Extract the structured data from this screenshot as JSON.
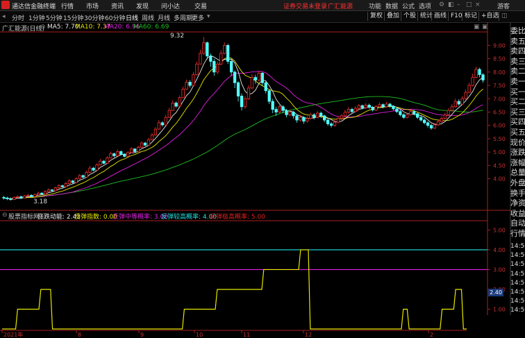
{
  "app": {
    "title": "通达信金融终端"
  },
  "menu": {
    "items": [
      "行情",
      "市场",
      "资讯",
      "发现",
      "问小达",
      "交易"
    ]
  },
  "menu_right": {
    "notice": "证券交易未登录",
    "account": "广汇能源",
    "items": [
      "功能",
      "数据",
      "公式",
      "选项"
    ],
    "guest": "游客"
  },
  "toolbar": {
    "periods": [
      "分时",
      "1分钟",
      "5分钟",
      "15分钟",
      "30分钟",
      "60分钟",
      "日线",
      "周线",
      "月线",
      "多周期",
      "更多"
    ],
    "active": "日线"
  },
  "toolbar_right": {
    "items": [
      "复权",
      "叠加",
      "个股",
      "统计",
      "画线",
      "F10",
      "标记",
      "+自选"
    ]
  },
  "main_chart": {
    "title": "广汇能源(日线)",
    "ma": [
      {
        "label": "MA5: 7.70",
        "color": "#e8e8e8"
      },
      {
        "label": "MA10: 7.37",
        "color": "#e8e800"
      },
      {
        "label": "MA20: 6.96",
        "color": "#e020e0"
      },
      {
        "label": "MA60: 6.69",
        "color": "#20c020"
      }
    ],
    "high_label": "9.32",
    "low_label": "3.18",
    "yticks": [
      "9.00",
      "8.50",
      "8.00",
      "7.50",
      "7.00",
      "6.50",
      "6.00",
      "5.50",
      "5.00",
      "4.50",
      "4.00"
    ]
  },
  "indicator": {
    "name": "股票指标网",
    "items": [
      {
        "label": "涨跌动能: 2.43",
        "color": "#e8e8e8"
      },
      {
        "label": "反弹指数: 0.00",
        "color": "#e8e800"
      },
      {
        "label": "反弹中等概率: 3.00",
        "color": "#e020e0"
      },
      {
        "label": "反弹较高概率: 4.00",
        "color": "#20e0e0"
      },
      {
        "label": "反弹极高概率: 5.00",
        "color": "#e02020"
      }
    ],
    "yticks": [
      "5.00",
      "4.00",
      "3.00",
      "2.00",
      "1.00"
    ],
    "current": "2.40"
  },
  "xaxis": {
    "labels": [
      "2021年",
      "8",
      "9",
      "10",
      "11",
      "12",
      "2"
    ]
  },
  "side": {
    "labels": [
      "委比",
      "卖五",
      "卖四",
      "卖三",
      "卖二",
      "卖一",
      "买一",
      "买二",
      "买三",
      "买四",
      "买五",
      "现价",
      "涨跌",
      "涨幅",
      "总量",
      "外盘",
      "换手",
      "净资",
      "收益",
      "自动",
      "行情"
    ],
    "times": [
      "14:50",
      "14:50",
      "14:50",
      "14:50",
      "14:50",
      "14:50",
      "14:50",
      "14:50",
      "14:50"
    ]
  },
  "colors": {
    "up": "#ff3232",
    "down": "#54ffff",
    "ma5": "#e8e8e8",
    "ma10": "#e8e800",
    "ma20": "#e020e0",
    "ma60": "#20c020",
    "line3": "#e020e0",
    "line4": "#20e0e0",
    "indicator": "#e8e800",
    "axis": "#aa2020"
  },
  "chart_data": {
    "type": "candlestick",
    "title": "广汇能源(日线)",
    "ylim": [
      3.0,
      9.4
    ],
    "candles": [
      [
        3.3,
        3.28,
        3.36,
        3.22
      ],
      [
        3.28,
        3.25,
        3.33,
        3.2
      ],
      [
        3.25,
        3.22,
        3.3,
        3.18
      ],
      [
        3.22,
        3.3,
        3.34,
        3.2
      ],
      [
        3.3,
        3.33,
        3.38,
        3.27
      ],
      [
        3.33,
        3.28,
        3.36,
        3.24
      ],
      [
        3.28,
        3.35,
        3.4,
        3.26
      ],
      [
        3.35,
        3.38,
        3.44,
        3.32
      ],
      [
        3.38,
        3.33,
        3.42,
        3.3
      ],
      [
        3.33,
        3.4,
        3.45,
        3.31
      ],
      [
        3.4,
        3.46,
        3.52,
        3.38
      ],
      [
        3.46,
        3.43,
        3.5,
        3.4
      ],
      [
        3.43,
        3.52,
        3.57,
        3.41
      ],
      [
        3.52,
        3.58,
        3.64,
        3.5
      ],
      [
        3.58,
        3.55,
        3.62,
        3.52
      ],
      [
        3.55,
        3.66,
        3.7,
        3.53
      ],
      [
        3.66,
        3.74,
        3.8,
        3.64
      ],
      [
        3.74,
        3.7,
        3.78,
        3.66
      ],
      [
        3.7,
        3.82,
        3.88,
        3.68
      ],
      [
        3.82,
        3.92,
        3.98,
        3.8
      ],
      [
        3.92,
        3.86,
        3.96,
        3.82
      ],
      [
        3.86,
        4.0,
        4.06,
        3.84
      ],
      [
        4.0,
        4.12,
        4.18,
        3.98
      ],
      [
        4.12,
        4.06,
        4.16,
        4.02
      ],
      [
        4.06,
        4.24,
        4.3,
        4.04
      ],
      [
        4.24,
        4.4,
        4.48,
        4.22
      ],
      [
        4.4,
        4.32,
        4.44,
        4.28
      ],
      [
        4.32,
        4.52,
        4.58,
        4.3
      ],
      [
        4.52,
        4.66,
        4.74,
        4.5
      ],
      [
        4.66,
        4.58,
        4.7,
        4.54
      ],
      [
        4.58,
        4.78,
        4.84,
        4.56
      ],
      [
        4.78,
        4.94,
        5.02,
        4.76
      ],
      [
        4.94,
        4.86,
        4.98,
        4.8
      ],
      [
        4.86,
        5.02,
        5.1,
        4.84
      ],
      [
        5.02,
        4.92,
        5.06,
        4.88
      ],
      [
        4.92,
        4.84,
        4.96,
        4.8
      ],
      [
        4.84,
        4.98,
        5.04,
        4.82
      ],
      [
        4.98,
        5.12,
        5.18,
        4.96
      ],
      [
        5.12,
        5.02,
        5.14,
        4.98
      ],
      [
        5.02,
        5.18,
        5.24,
        5.0
      ],
      [
        5.18,
        5.34,
        5.4,
        5.16
      ],
      [
        5.34,
        5.26,
        5.38,
        5.22
      ],
      [
        5.26,
        5.46,
        5.54,
        5.24
      ],
      [
        5.46,
        5.64,
        5.72,
        5.44
      ],
      [
        5.64,
        5.86,
        5.94,
        5.62
      ],
      [
        5.86,
        6.1,
        6.2,
        5.84
      ],
      [
        6.1,
        6.02,
        6.16,
        5.96
      ],
      [
        6.02,
        6.3,
        6.4,
        6.0
      ],
      [
        6.3,
        6.56,
        6.66,
        6.28
      ],
      [
        6.56,
        6.84,
        6.94,
        6.54
      ],
      [
        6.84,
        6.72,
        6.9,
        6.66
      ],
      [
        6.72,
        7.04,
        7.12,
        6.7
      ],
      [
        7.04,
        7.36,
        7.46,
        7.02
      ],
      [
        7.36,
        7.62,
        7.72,
        7.34
      ],
      [
        7.62,
        7.5,
        7.7,
        7.42
      ],
      [
        7.5,
        7.9,
        8.0,
        7.48
      ],
      [
        7.9,
        8.3,
        8.4,
        7.88
      ],
      [
        8.3,
        8.7,
        8.84,
        8.28
      ],
      [
        8.7,
        9.1,
        9.32,
        8.64
      ],
      [
        9.1,
        8.6,
        9.14,
        8.48
      ],
      [
        8.6,
        8.4,
        8.7,
        8.2
      ],
      [
        8.4,
        8.0,
        8.5,
        7.86
      ],
      [
        8.0,
        8.3,
        8.4,
        7.92
      ],
      [
        8.3,
        8.7,
        8.82,
        8.26
      ],
      [
        8.7,
        9.0,
        9.12,
        8.66
      ],
      [
        9.0,
        8.4,
        9.06,
        8.3
      ],
      [
        8.4,
        8.0,
        8.46,
        7.86
      ],
      [
        8.0,
        7.6,
        8.06,
        7.4
      ],
      [
        7.6,
        7.1,
        7.66,
        6.9
      ],
      [
        7.1,
        6.7,
        7.2,
        6.56
      ],
      [
        6.7,
        7.0,
        7.1,
        6.62
      ],
      [
        7.0,
        7.4,
        7.5,
        6.96
      ],
      [
        7.4,
        7.8,
        7.92,
        7.36
      ],
      [
        7.8,
        7.7,
        7.9,
        7.56
      ],
      [
        7.7,
        7.96,
        8.04,
        7.64
      ],
      [
        7.96,
        7.6,
        8.0,
        7.5
      ],
      [
        7.6,
        7.3,
        7.66,
        7.2
      ],
      [
        7.3,
        6.9,
        7.36,
        6.8
      ],
      [
        6.9,
        6.6,
        7.0,
        6.46
      ],
      [
        6.6,
        6.5,
        6.7,
        6.36
      ],
      [
        6.5,
        6.7,
        6.8,
        6.42
      ],
      [
        6.7,
        6.56,
        6.76,
        6.46
      ],
      [
        6.56,
        6.4,
        6.62,
        6.3
      ],
      [
        6.4,
        6.5,
        6.6,
        6.34
      ],
      [
        6.5,
        6.36,
        6.54,
        6.26
      ],
      [
        6.36,
        6.2,
        6.42,
        6.1
      ],
      [
        6.2,
        6.3,
        6.4,
        6.14
      ],
      [
        6.3,
        6.16,
        6.34,
        6.06
      ],
      [
        6.16,
        6.26,
        6.34,
        6.1
      ],
      [
        6.26,
        6.4,
        6.48,
        6.22
      ],
      [
        6.4,
        6.3,
        6.46,
        6.22
      ],
      [
        6.3,
        6.46,
        6.54,
        6.26
      ],
      [
        6.46,
        6.36,
        6.52,
        6.28
      ],
      [
        6.36,
        6.2,
        6.4,
        6.12
      ],
      [
        6.2,
        6.06,
        6.26,
        5.98
      ],
      [
        6.06,
        6.0,
        6.12,
        5.92
      ],
      [
        6.0,
        6.12,
        6.2,
        5.94
      ],
      [
        6.12,
        6.26,
        6.34,
        6.08
      ],
      [
        6.26,
        6.36,
        6.44,
        6.2
      ],
      [
        6.36,
        6.5,
        6.58,
        6.3
      ],
      [
        6.5,
        6.6,
        6.68,
        6.44
      ],
      [
        6.6,
        6.52,
        6.66,
        6.46
      ],
      [
        6.52,
        6.64,
        6.72,
        6.48
      ],
      [
        6.64,
        6.74,
        6.8,
        6.58
      ],
      [
        6.74,
        6.66,
        6.78,
        6.6
      ],
      [
        6.66,
        6.76,
        6.84,
        6.62
      ],
      [
        6.76,
        6.68,
        6.82,
        6.62
      ],
      [
        6.68,
        6.58,
        6.72,
        6.52
      ],
      [
        6.58,
        6.7,
        6.76,
        6.54
      ],
      [
        6.7,
        6.78,
        6.86,
        6.66
      ],
      [
        6.78,
        6.7,
        6.82,
        6.64
      ],
      [
        6.7,
        6.8,
        6.88,
        6.66
      ],
      [
        6.8,
        6.72,
        6.84,
        6.66
      ],
      [
        6.72,
        6.62,
        6.76,
        6.56
      ],
      [
        6.62,
        6.52,
        6.66,
        6.46
      ],
      [
        6.52,
        6.4,
        6.58,
        6.34
      ],
      [
        6.4,
        6.3,
        6.46,
        6.24
      ],
      [
        6.3,
        6.4,
        6.48,
        6.26
      ],
      [
        6.4,
        6.52,
        6.6,
        6.36
      ],
      [
        6.52,
        6.44,
        6.58,
        6.38
      ],
      [
        6.44,
        6.3,
        6.48,
        6.24
      ],
      [
        6.3,
        6.2,
        6.36,
        6.14
      ],
      [
        6.2,
        6.1,
        6.26,
        6.04
      ],
      [
        6.1,
        6.0,
        6.16,
        5.92
      ],
      [
        6.0,
        5.9,
        6.06,
        5.84
      ],
      [
        5.9,
        6.02,
        6.08,
        5.86
      ],
      [
        6.02,
        6.14,
        6.22,
        5.98
      ],
      [
        6.14,
        6.26,
        6.34,
        6.1
      ],
      [
        6.26,
        6.4,
        6.48,
        6.22
      ],
      [
        6.4,
        6.56,
        6.64,
        6.36
      ],
      [
        6.56,
        6.7,
        6.8,
        6.52
      ],
      [
        6.7,
        6.9,
        7.0,
        6.66
      ],
      [
        6.9,
        6.8,
        6.98,
        6.74
      ],
      [
        6.8,
        7.0,
        7.1,
        6.76
      ],
      [
        7.0,
        7.24,
        7.34,
        6.96
      ],
      [
        7.24,
        7.5,
        7.6,
        7.2
      ],
      [
        7.5,
        7.8,
        7.94,
        7.46
      ],
      [
        7.8,
        8.1,
        8.2,
        7.76
      ],
      [
        8.1,
        7.9,
        8.16,
        7.8
      ],
      [
        7.9,
        7.7,
        7.96,
        7.6
      ]
    ],
    "indicator_line": [
      0,
      0,
      0,
      0,
      0,
      0,
      0,
      0,
      1,
      1,
      1,
      1,
      1,
      1,
      1,
      1,
      1,
      1,
      1,
      1,
      2,
      2,
      2,
      2,
      2,
      2,
      0,
      0,
      0,
      0,
      0,
      0,
      0,
      0,
      0,
      0,
      0,
      0,
      0,
      0,
      0,
      0,
      0,
      0,
      0,
      0,
      0,
      0,
      0,
      0,
      0,
      0,
      0,
      0,
      0,
      0,
      0,
      0,
      0,
      0,
      0,
      0,
      0,
      0,
      0,
      0,
      0,
      0,
      0,
      0,
      0,
      0,
      0,
      0,
      0,
      0,
      0,
      0,
      0,
      0,
      0,
      0,
      0,
      0,
      0,
      0,
      0,
      0,
      0,
      0,
      0,
      0,
      0,
      0,
      1,
      1,
      1,
      1,
      1,
      1,
      1,
      1,
      1,
      1,
      1,
      1,
      1,
      1,
      1,
      1,
      1,
      2,
      2,
      2,
      2,
      2,
      2,
      2,
      2,
      2,
      2,
      2,
      2,
      2,
      2,
      2,
      2,
      2,
      2,
      2,
      2,
      2,
      2,
      2,
      2,
      3,
      3,
      3,
      3,
      3,
      3,
      3,
      3,
      3,
      3,
      3,
      3,
      3,
      3,
      3,
      3,
      3,
      3,
      3,
      4,
      4,
      4,
      4,
      4,
      0,
      0,
      0,
      0,
      0,
      0,
      0,
      0,
      0,
      0,
      0,
      0,
      0,
      0,
      0,
      0,
      0,
      0,
      0,
      0,
      0,
      0,
      0,
      0,
      0,
      0,
      0,
      0,
      0,
      0,
      0,
      0,
      0,
      0,
      0,
      0,
      0,
      0,
      0,
      0,
      0,
      0,
      0,
      0,
      0,
      0,
      0,
      0,
      1,
      1,
      1,
      0,
      0,
      0,
      0,
      0,
      0,
      0,
      0,
      0,
      0,
      0,
      0,
      0,
      0,
      0,
      0,
      0,
      1,
      1,
      1,
      1,
      1,
      1,
      1,
      2,
      2,
      2,
      2,
      0,
      0,
      0,
      0,
      0,
      0,
      0,
      0,
      0,
      0,
      0,
      0
    ]
  }
}
